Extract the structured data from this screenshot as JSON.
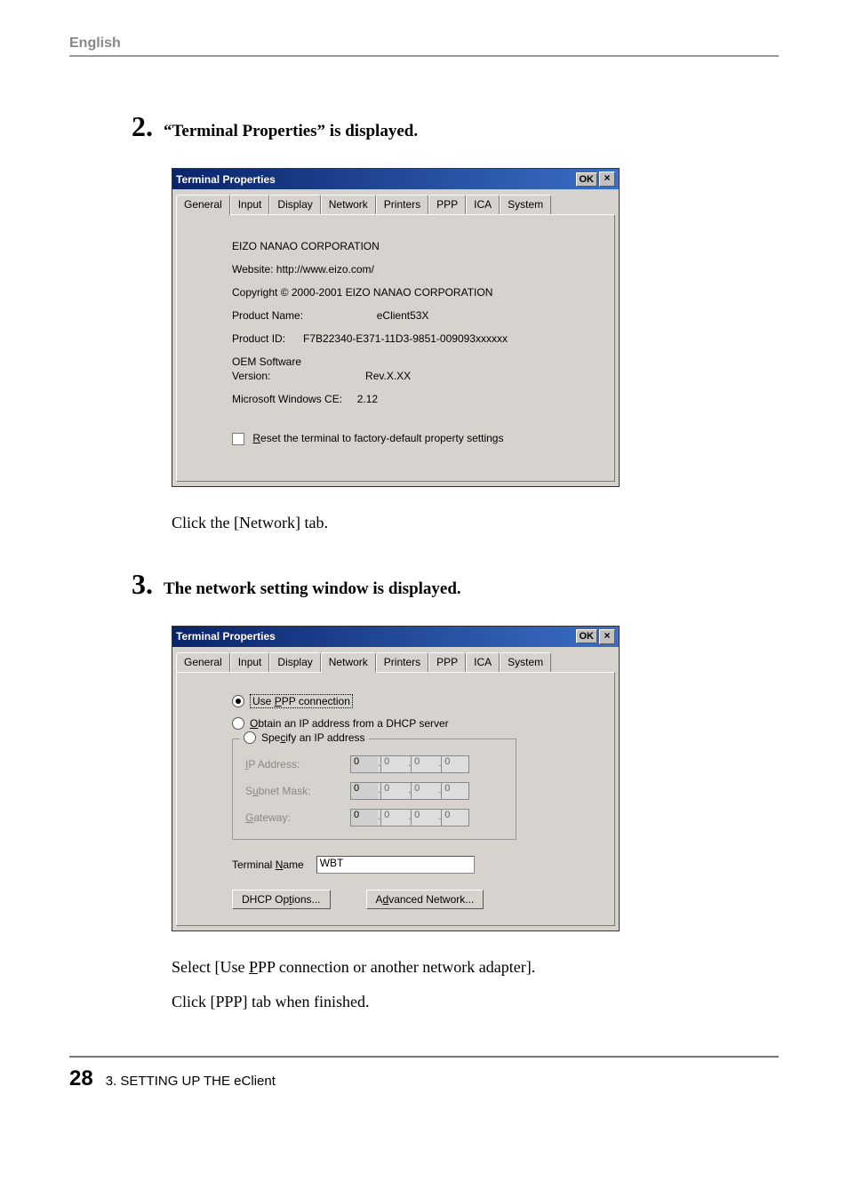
{
  "header": {
    "language": "English"
  },
  "steps": {
    "s2": {
      "num": "2.",
      "text": "“Terminal Properties” is displayed."
    },
    "s2_after": "Click the [Network] tab.",
    "s3": {
      "num": "3.",
      "text": "The network setting window is displayed."
    },
    "s3_after1": "Select [Use PPP connection or another network adapter].",
    "s3_after2": "Click [PPP] tab when finished."
  },
  "win1": {
    "title": "Terminal Properties",
    "ok": "OK",
    "close": "×",
    "tabs": [
      "General",
      "Input",
      "Display",
      "Network",
      "Printers",
      "PPP",
      "ICA",
      "System"
    ],
    "active_tab": "General",
    "company": "EIZO NANAO CORPORATION",
    "website": "Website:  http://www.eizo.com/",
    "copyright": "Copyright © 2000-2001 EIZO NANAO CORPORATION",
    "product_name_lbl": "Product Name:",
    "product_name_val": "eClient53X",
    "product_id_lbl": "Product ID:",
    "product_id_val": "F7B22340-E371-11D3-9851-009093xxxxxx",
    "oem_lbl1": "OEM Software",
    "oem_lbl2": "Version:",
    "oem_val": "Rev.X.XX",
    "ce_lbl": "Microsoft Windows CE:",
    "ce_val": "2.12",
    "reset_u": "R",
    "reset_rest": "eset the terminal to factory-default property settings"
  },
  "win2": {
    "title": "Terminal Properties",
    "ok": "OK",
    "close": "×",
    "tabs": [
      "General",
      "Input",
      "Display",
      "Network",
      "Printers",
      "PPP",
      "ICA",
      "System"
    ],
    "active_tab": "Network",
    "radio_ppp": "Use PPP connection",
    "radio_dhcp": "Obtain an IP address from a DHCP server",
    "radio_spec": "Specify an IP address",
    "ip_lbl": "IP Address:",
    "subnet_lbl": "Subnet Mask:",
    "gateway_lbl": "Gateway:",
    "ip_val": [
      "0",
      "0",
      "0",
      "0"
    ],
    "subnet_val": [
      "0",
      "0",
      "0",
      "0"
    ],
    "gateway_val": [
      "0",
      "0",
      "0",
      "0"
    ],
    "terminal_name_lbl": "Terminal Name",
    "terminal_name_val": "WBT",
    "dhcp_btn": "DHCP Options...",
    "adv_btn": "Advanced Network..."
  },
  "footer": {
    "page": "28",
    "chapter": "3. SETTING UP THE eClient"
  }
}
